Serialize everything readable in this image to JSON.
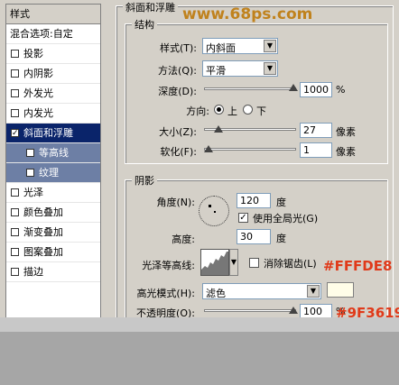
{
  "watermark": "www.68ps.com",
  "left_panel": {
    "title": "样式",
    "blend": "混合选项:自定",
    "items": [
      {
        "label": "投影",
        "checked": false
      },
      {
        "label": "内阴影",
        "checked": false
      },
      {
        "label": "外发光",
        "checked": false
      },
      {
        "label": "内发光",
        "checked": false
      },
      {
        "label": "斜面和浮雕",
        "checked": true
      },
      {
        "label": "等高线",
        "checked": false
      },
      {
        "label": "纹理",
        "checked": false
      },
      {
        "label": "光泽",
        "checked": false
      },
      {
        "label": "颜色叠加",
        "checked": false
      },
      {
        "label": "渐变叠加",
        "checked": false
      },
      {
        "label": "图案叠加",
        "checked": false
      },
      {
        "label": "描边",
        "checked": false
      }
    ]
  },
  "bevel": {
    "title": "斜面和浮雕",
    "structure": {
      "title": "结构",
      "style_label": "样式(T):",
      "style_value": "内斜面",
      "technique_label": "方法(Q):",
      "technique_value": "平滑",
      "depth_label": "深度(D):",
      "depth_value": "1000",
      "depth_unit": "%",
      "direction_label": "方向:",
      "dir_up": "上",
      "dir_down": "下",
      "size_label": "大小(Z):",
      "size_value": "27",
      "size_unit": "像素",
      "soften_label": "软化(F):",
      "soften_value": "1",
      "soften_unit": "像素"
    },
    "shading": {
      "title": "阴影",
      "angle_label": "角度(N):",
      "angle_value": "120",
      "angle_unit": "度",
      "global_light": "使用全局光(G)",
      "global_light_checked": true,
      "altitude_label": "高度:",
      "altitude_value": "30",
      "altitude_unit": "度",
      "gloss_label": "光泽等高线:",
      "antialias": "消除锯齿(L)",
      "antialias_checked": false,
      "highlight_label": "高光模式(H):",
      "highlight_value": "滤色",
      "highlight_color": "#FFFDE8",
      "opacity_label": "不透明度(O):",
      "opacity_value": "100",
      "opacity_unit": "%"
    }
  },
  "annotations": {
    "highlight_color": "#FFFDE8",
    "shadow_color": "#9F3619"
  }
}
